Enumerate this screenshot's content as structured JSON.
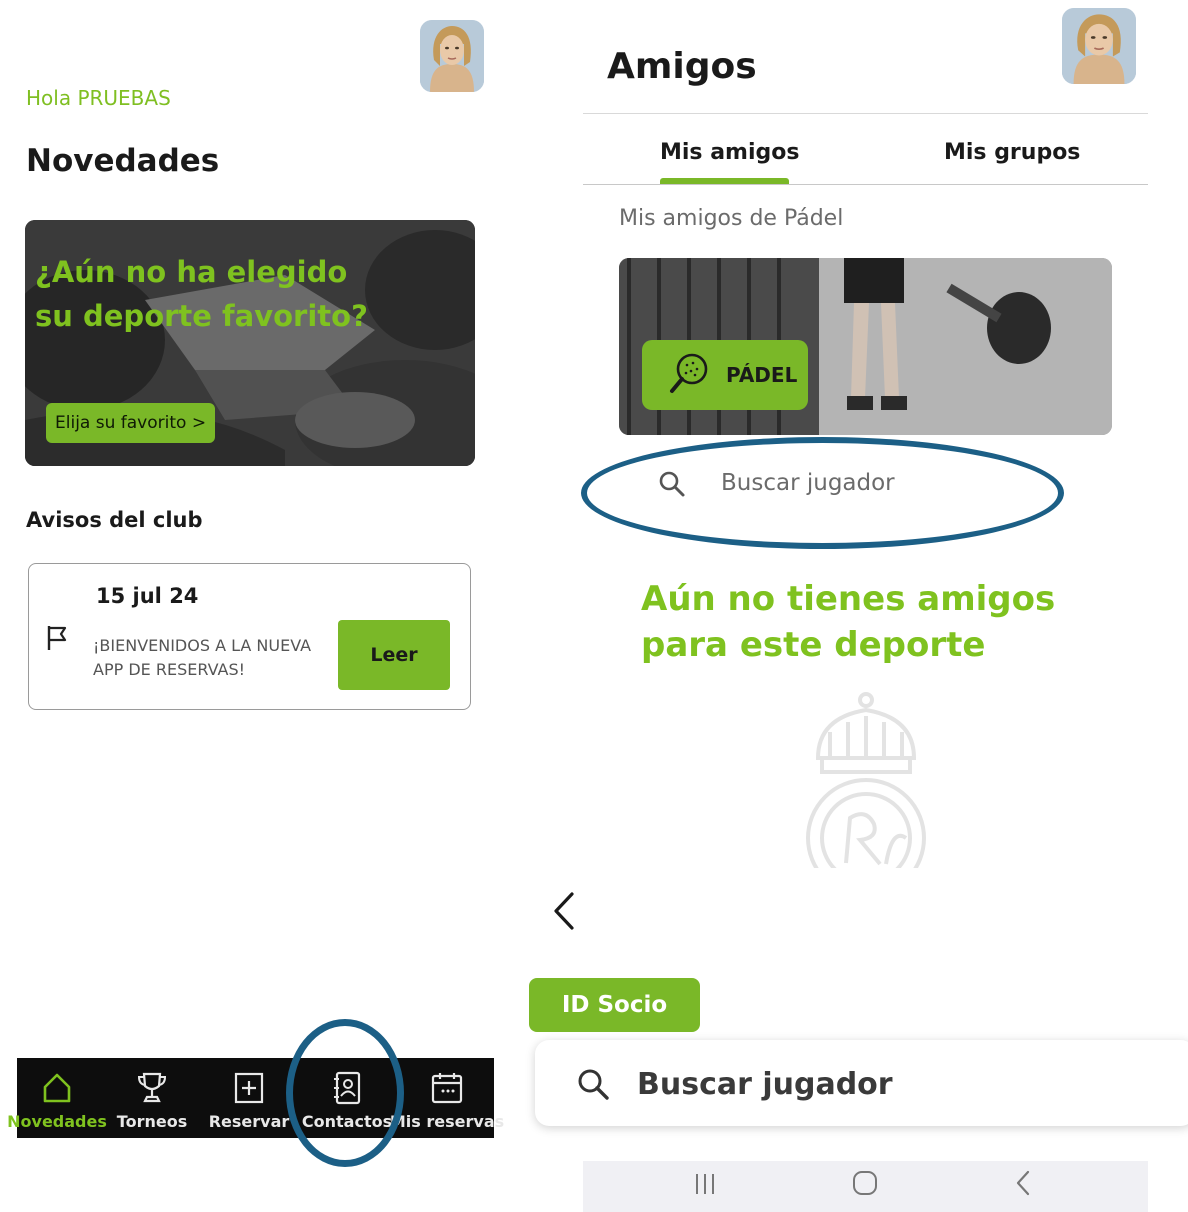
{
  "left_screen": {
    "greeting": "Hola PRUEBAS",
    "section_title": "Novedades",
    "banner": {
      "headline": "¿Aún no ha elegido su deporte favorito?",
      "button_label": "Elija su favorito >"
    },
    "avisos_title": "Avisos del club",
    "notice": {
      "date": "15 jul 24",
      "text": "¡BIENVENIDOS A LA NUEVA APP DE RESERVAS!",
      "button_label": "Leer"
    },
    "bottom_nav": {
      "items": [
        {
          "label": "Novedades",
          "icon": "home-icon",
          "active": true
        },
        {
          "label": "Torneos",
          "icon": "trophy-icon",
          "active": false
        },
        {
          "label": "Reservar",
          "icon": "plus-square-icon",
          "active": false
        },
        {
          "label": "Contactos",
          "icon": "contacts-icon",
          "active": false
        },
        {
          "label": "Mis reservas",
          "icon": "calendar-icon",
          "active": false
        }
      ]
    }
  },
  "right_screen": {
    "title": "Amigos",
    "tabs": [
      {
        "label": "Mis amigos",
        "active": true
      },
      {
        "label": "Mis grupos",
        "active": false
      }
    ],
    "subheading": "Mis amigos de Pádel",
    "sport_card": {
      "label": "PÁDEL",
      "icon": "padel-racket-icon"
    },
    "search_placeholder": "Buscar jugador",
    "empty_message": "Aún no tienes amigos para este deporte"
  },
  "lower_screen": {
    "id_socio_label": "ID Socio",
    "search_placeholder": "Buscar jugador"
  },
  "colors": {
    "accent_green": "#7ab828",
    "highlight_ring": "#1c5f86",
    "nav_background": "#0d0d0d"
  }
}
